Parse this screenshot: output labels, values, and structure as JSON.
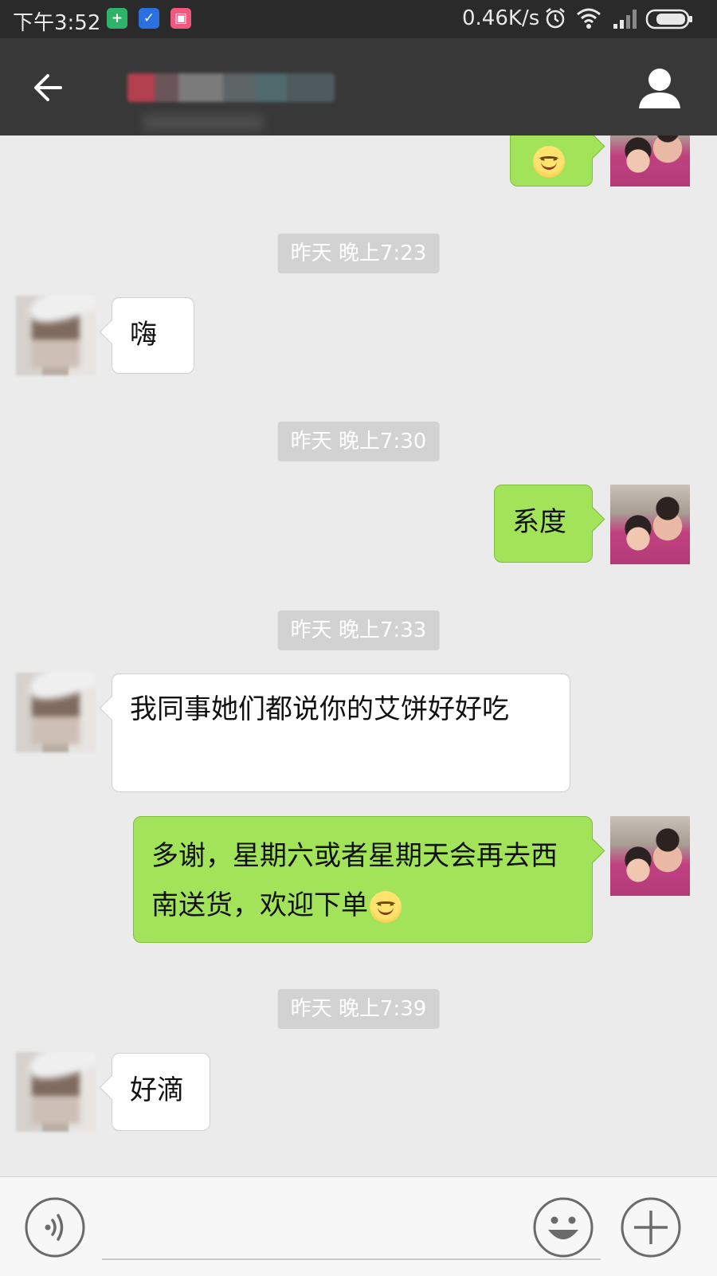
{
  "status_bar": {
    "time": "下午3:52",
    "network_speed": "0.46K/s",
    "app_icons": [
      {
        "name": "shield-plus-icon",
        "color": "#2fb36a"
      },
      {
        "name": "check-shield-icon",
        "color": "#2b6fe0"
      },
      {
        "name": "app-badge-icon",
        "color": "#f0587e"
      }
    ],
    "system_icons": [
      "alarm-icon",
      "wifi-icon",
      "signal-icon",
      "battery-icon"
    ]
  },
  "header": {
    "title": "",
    "title_obscured": true,
    "back_icon": "back-arrow-icon",
    "profile_icon": "person-icon"
  },
  "messages": [
    {
      "type": "outgoing",
      "content": "emoji",
      "emoji": "smile-blush"
    },
    {
      "type": "timestamp",
      "text": "昨天 晚上7:23"
    },
    {
      "type": "incoming",
      "text": "嗨"
    },
    {
      "type": "timestamp",
      "text": "昨天 晚上7:30"
    },
    {
      "type": "outgoing",
      "text": "系度"
    },
    {
      "type": "timestamp",
      "text": "昨天 晚上7:33"
    },
    {
      "type": "incoming",
      "text": "我同事她们都说你的艾饼好好吃"
    },
    {
      "type": "outgoing",
      "text": "多谢，星期六或者星期天会再去西南送货，欢迎下单",
      "emoji": "smile-blush"
    },
    {
      "type": "timestamp",
      "text": "昨天 晚上7:39"
    },
    {
      "type": "incoming",
      "text": "好滴"
    }
  ],
  "input_bar": {
    "value": "",
    "voice_icon": "voice-icon",
    "emoji_icon": "emoji-face-icon",
    "plus_icon": "plus-icon"
  },
  "colors": {
    "status_bar_bg": "#2a2a2a",
    "nav_bg": "#383838",
    "chat_bg": "#ebebeb",
    "outgoing_bubble": "#a3e35a",
    "incoming_bubble": "#ffffff",
    "timestamp_bg": "#d2d2d2"
  }
}
